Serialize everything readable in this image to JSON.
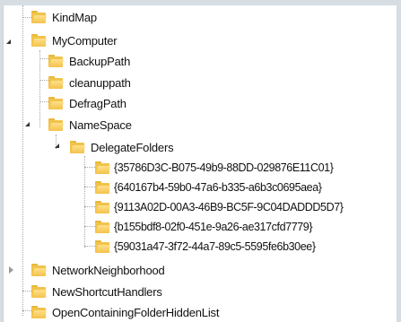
{
  "tree": {
    "items": [
      {
        "label": "KindMap"
      },
      {
        "label": "MyComputer"
      },
      {
        "label": "BackupPath"
      },
      {
        "label": "cleanuppath"
      },
      {
        "label": "DefragPath"
      },
      {
        "label": "NameSpace"
      },
      {
        "label": "DelegateFolders"
      },
      {
        "label": "{35786D3C-B075-49b9-88DD-029876E11C01}"
      },
      {
        "label": "{640167b4-59b0-47a6-b335-a6b3c0695aea}"
      },
      {
        "label": "{9113A02D-00A3-46B9-BC5F-9C04DADDD5D7}"
      },
      {
        "label": "{b155bdf8-02f0-451e-9a26-ae317cfd7779}"
      },
      {
        "label": "{59031a47-3f72-44a7-89c5-5595fe6b30ee}"
      },
      {
        "label": "NetworkNeighborhood"
      },
      {
        "label": "NewShortcutHandlers"
      },
      {
        "label": "OpenContainingFolderHiddenList"
      }
    ]
  }
}
